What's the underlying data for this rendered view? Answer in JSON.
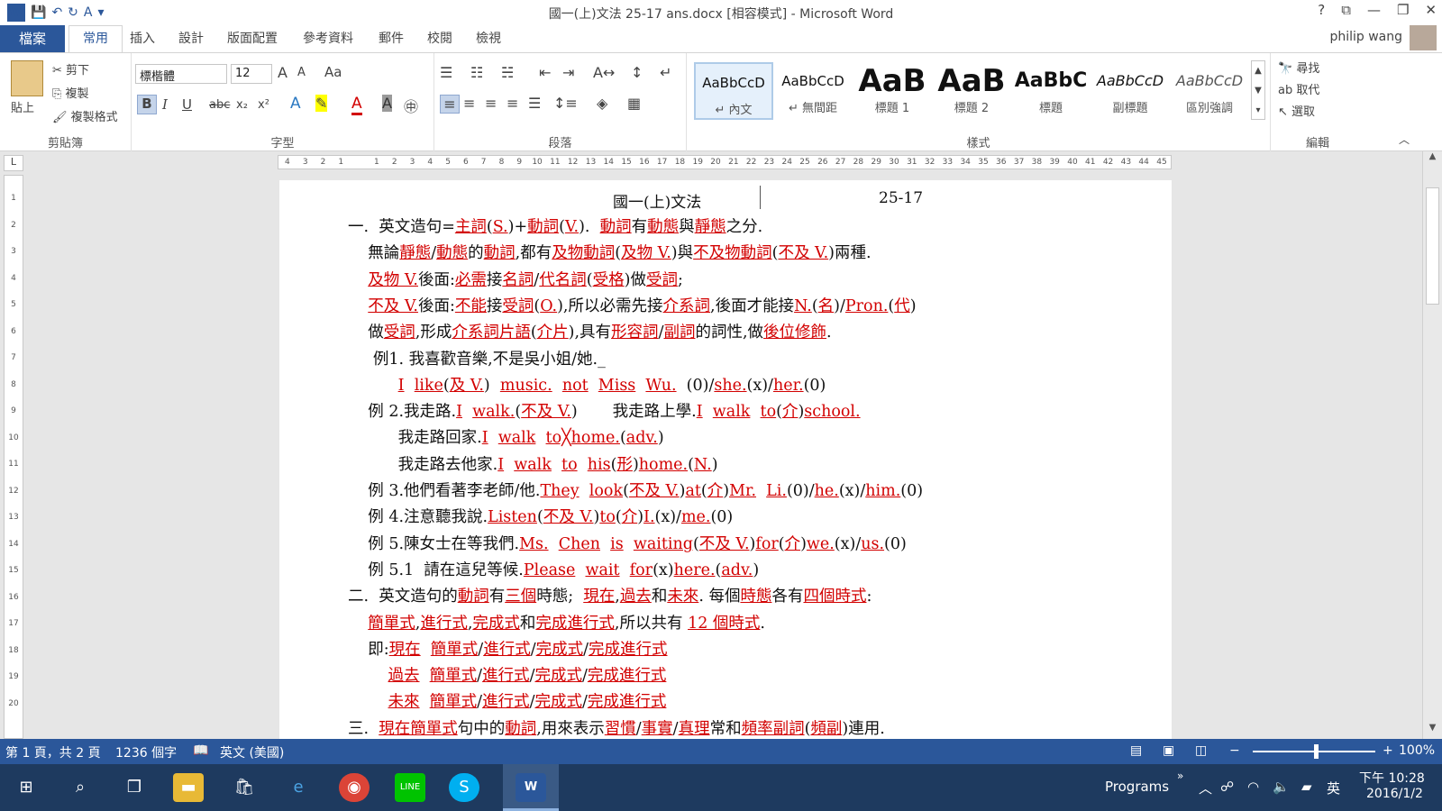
{
  "window": {
    "title": "國一(上)文法 25-17 ans.docx [相容模式] - Microsoft Word",
    "controls": {
      "help": "?",
      "restore": "⧉",
      "minimize": "—",
      "maximize": "❐",
      "close": "✕"
    }
  },
  "quick_access": {
    "app": "W",
    "save": "💾",
    "undo": "↶",
    "redo": "↻",
    "format": "A",
    "more": "▾"
  },
  "tabs": [
    "檔案",
    "常用",
    "插入",
    "設計",
    "版面配置",
    "參考資料",
    "郵件",
    "校閱",
    "檢視"
  ],
  "user": "philip wang",
  "ribbon": {
    "clipboard": {
      "label": "剪貼簿",
      "paste": "貼上",
      "cut": "剪下",
      "copy": "複製",
      "format_painter": "複製格式"
    },
    "font": {
      "label": "字型",
      "font_name": "標楷體",
      "font_size": "12",
      "grow": "A",
      "shrink": "A",
      "case": "Aa",
      "bold": "B",
      "italic": "I",
      "underline": "U",
      "strike": "abc",
      "sub": "x₂",
      "sup": "x²"
    },
    "paragraph": {
      "label": "段落"
    },
    "styles": {
      "label": "樣式",
      "items": [
        {
          "sample": "AaBbCcD",
          "name": "↵ 內文"
        },
        {
          "sample": "AaBbCcD",
          "name": "↵ 無間距"
        },
        {
          "sample": "AaB",
          "name": "標題 1"
        },
        {
          "sample": "AaB",
          "name": "標題 2"
        },
        {
          "sample": "AaBbC",
          "name": "標題"
        },
        {
          "sample": "AaBbCcD",
          "name": "副標題"
        },
        {
          "sample": "AaBbCcD",
          "name": "區別強調"
        }
      ]
    },
    "editing": {
      "label": "編輯",
      "find": "尋找",
      "replace": "取代",
      "select": "選取"
    }
  },
  "ruler": [
    "4",
    "3",
    "2",
    "1",
    "",
    "1",
    "2",
    "3",
    "4",
    "5",
    "6",
    "7",
    "8",
    "9",
    "10",
    "11",
    "12",
    "13",
    "14",
    "15",
    "16",
    "17",
    "18",
    "19",
    "20",
    "21",
    "22",
    "23",
    "24",
    "25",
    "26",
    "27",
    "28",
    "29",
    "30",
    "31",
    "32",
    "33",
    "34",
    "35",
    "36",
    "37",
    "38",
    "39",
    "40",
    "41",
    "42",
    "43",
    "44",
    "45"
  ],
  "vruler": [
    "1",
    "2",
    "3",
    "4",
    "5",
    "6",
    "7",
    "8",
    "9",
    "10",
    "11",
    "12",
    "13",
    "14",
    "15",
    "16",
    "17",
    "18",
    "19",
    "20"
  ],
  "document": {
    "header_title": "國一(上)文法",
    "header_num": "25-17",
    "lines": [
      [
        {
          "t": "一.  英文造句="
        },
        {
          "t": "主詞",
          "r": true
        },
        {
          "t": "("
        },
        {
          "t": "S.",
          "r": true
        },
        {
          "t": ")+"
        },
        {
          "t": "動詞",
          "r": true
        },
        {
          "t": "("
        },
        {
          "t": "V.",
          "r": true
        },
        {
          "t": ").  "
        },
        {
          "t": "動詞",
          "r": true
        },
        {
          "t": "有"
        },
        {
          "t": "動態",
          "r": true
        },
        {
          "t": "與"
        },
        {
          "t": "靜態",
          "r": true
        },
        {
          "t": "之分."
        }
      ],
      [
        {
          "t": "    無論"
        },
        {
          "t": "靜態",
          "r": true
        },
        {
          "t": "/"
        },
        {
          "t": "動態",
          "r": true
        },
        {
          "t": "的"
        },
        {
          "t": "動詞",
          "r": true
        },
        {
          "t": ",都有"
        },
        {
          "t": "及物動詞",
          "r": true
        },
        {
          "t": "("
        },
        {
          "t": "及物 V.",
          "r": true
        },
        {
          "t": ")與"
        },
        {
          "t": "不及物動詞",
          "r": true
        },
        {
          "t": "("
        },
        {
          "t": "不及 V.",
          "r": true
        },
        {
          "t": ")兩種."
        }
      ],
      [
        {
          "t": "    "
        },
        {
          "t": "及物 V.",
          "r": true
        },
        {
          "t": "後面:"
        },
        {
          "t": "必需",
          "r": true
        },
        {
          "t": "接"
        },
        {
          "t": "名詞",
          "r": true
        },
        {
          "t": "/"
        },
        {
          "t": "代名詞",
          "r": true
        },
        {
          "t": "("
        },
        {
          "t": "受格",
          "r": true
        },
        {
          "t": ")做"
        },
        {
          "t": "受詞",
          "r": true
        },
        {
          "t": ";"
        }
      ],
      [
        {
          "t": "    "
        },
        {
          "t": "不及 V.",
          "r": true
        },
        {
          "t": "後面:"
        },
        {
          "t": "不能",
          "r": true
        },
        {
          "t": "接"
        },
        {
          "t": "受詞",
          "r": true
        },
        {
          "t": "("
        },
        {
          "t": "O.",
          "r": true
        },
        {
          "t": "),所以必需先接"
        },
        {
          "t": "介系詞",
          "r": true
        },
        {
          "t": ",後面才能接"
        },
        {
          "t": "N.",
          "r": true
        },
        {
          "t": "("
        },
        {
          "t": "名",
          "r": true
        },
        {
          "t": ")/"
        },
        {
          "t": "Pron.",
          "r": true
        },
        {
          "t": "("
        },
        {
          "t": "代",
          "r": true
        },
        {
          "t": ")"
        }
      ],
      [
        {
          "t": "    做"
        },
        {
          "t": "受詞",
          "r": true
        },
        {
          "t": ",形成"
        },
        {
          "t": "介系詞片語",
          "r": true
        },
        {
          "t": "("
        },
        {
          "t": "介片",
          "r": true
        },
        {
          "t": "),具有"
        },
        {
          "t": "形容詞",
          "r": true
        },
        {
          "t": "/"
        },
        {
          "t": "副詞",
          "r": true
        },
        {
          "t": "的詞性,做"
        },
        {
          "t": "後位修飾",
          "r": true
        },
        {
          "t": "."
        }
      ],
      [
        {
          "t": "     例1. 我喜歡音樂,不是吳小姐/她._"
        }
      ],
      [
        {
          "t": "          "
        },
        {
          "t": "I",
          "r": true
        },
        {
          "t": "  "
        },
        {
          "t": "like",
          "r": true
        },
        {
          "t": "("
        },
        {
          "t": "及 V.",
          "r": true
        },
        {
          "t": ")  "
        },
        {
          "t": "music.",
          "r": true
        },
        {
          "t": "  "
        },
        {
          "t": "not",
          "r": true
        },
        {
          "t": "  "
        },
        {
          "t": "Miss",
          "r": true
        },
        {
          "t": "  "
        },
        {
          "t": "Wu.",
          "r": true
        },
        {
          "t": "  (0)/"
        },
        {
          "t": "she.",
          "r": true
        },
        {
          "t": "(x)/"
        },
        {
          "t": "her.",
          "r": true
        },
        {
          "t": "(0)"
        }
      ],
      [
        {
          "t": "    例 2.我走路."
        },
        {
          "t": "I",
          "r": true
        },
        {
          "t": "  "
        },
        {
          "t": "walk.",
          "r": true
        },
        {
          "t": "("
        },
        {
          "t": "不及 V.",
          "r": true
        },
        {
          "t": ")       我走路上學."
        },
        {
          "t": "I",
          "r": true
        },
        {
          "t": "  "
        },
        {
          "t": "walk",
          "r": true
        },
        {
          "t": "  "
        },
        {
          "t": "to",
          "r": true
        },
        {
          "t": "("
        },
        {
          "t": "介",
          "r": true
        },
        {
          "t": ")"
        },
        {
          "t": "school.",
          "r": true
        }
      ],
      [
        {
          "t": "          我走路回家."
        },
        {
          "t": "I",
          "r": true
        },
        {
          "t": "  "
        },
        {
          "t": "walk",
          "r": true
        },
        {
          "t": "  "
        },
        {
          "t": "to╳",
          "r": true
        },
        {
          "t": "home.",
          "r": true
        },
        {
          "t": "("
        },
        {
          "t": "adv.",
          "r": true
        },
        {
          "t": ")"
        }
      ],
      [
        {
          "t": "          我走路去他家."
        },
        {
          "t": "I",
          "r": true
        },
        {
          "t": "  "
        },
        {
          "t": "walk",
          "r": true
        },
        {
          "t": "  "
        },
        {
          "t": "to",
          "r": true
        },
        {
          "t": "  "
        },
        {
          "t": "his",
          "r": true
        },
        {
          "t": "("
        },
        {
          "t": "形",
          "r": true
        },
        {
          "t": ")"
        },
        {
          "t": "home.",
          "r": true
        },
        {
          "t": "("
        },
        {
          "t": "N.",
          "r": true
        },
        {
          "t": ")"
        }
      ],
      [
        {
          "t": "    例 3.他們看著李老師/他."
        },
        {
          "t": "They",
          "r": true
        },
        {
          "t": "  "
        },
        {
          "t": "look",
          "r": true
        },
        {
          "t": "("
        },
        {
          "t": "不及 V.",
          "r": true
        },
        {
          "t": ")"
        },
        {
          "t": "at",
          "r": true
        },
        {
          "t": "("
        },
        {
          "t": "介",
          "r": true
        },
        {
          "t": ")"
        },
        {
          "t": "Mr.",
          "r": true
        },
        {
          "t": "  "
        },
        {
          "t": "Li.",
          "r": true
        },
        {
          "t": "(0)/"
        },
        {
          "t": "he.",
          "r": true
        },
        {
          "t": "(x)/"
        },
        {
          "t": "him.",
          "r": true
        },
        {
          "t": "(0)"
        }
      ],
      [
        {
          "t": "    例 4.注意聽我說."
        },
        {
          "t": "Listen",
          "r": true
        },
        {
          "t": "("
        },
        {
          "t": "不及 V.",
          "r": true
        },
        {
          "t": ")"
        },
        {
          "t": "to",
          "r": true
        },
        {
          "t": "("
        },
        {
          "t": "介",
          "r": true
        },
        {
          "t": ")"
        },
        {
          "t": "I.",
          "r": true
        },
        {
          "t": "(x)/"
        },
        {
          "t": "me.",
          "r": true
        },
        {
          "t": "(0)"
        }
      ],
      [
        {
          "t": "    例 5.陳女士在等我們."
        },
        {
          "t": "Ms.",
          "r": true
        },
        {
          "t": "  "
        },
        {
          "t": "Chen",
          "r": true
        },
        {
          "t": "  "
        },
        {
          "t": "is",
          "r": true
        },
        {
          "t": "  "
        },
        {
          "t": "waiting",
          "r": true
        },
        {
          "t": "("
        },
        {
          "t": "不及 V.",
          "r": true
        },
        {
          "t": ")"
        },
        {
          "t": "for",
          "r": true
        },
        {
          "t": "("
        },
        {
          "t": "介",
          "r": true
        },
        {
          "t": ")"
        },
        {
          "t": "we.",
          "r": true
        },
        {
          "t": "(x)/"
        },
        {
          "t": "us.",
          "r": true
        },
        {
          "t": "(0)"
        }
      ],
      [
        {
          "t": "    例 5.1  請在這兒等候."
        },
        {
          "t": "Please",
          "r": true
        },
        {
          "t": "  "
        },
        {
          "t": "wait",
          "r": true
        },
        {
          "t": "  "
        },
        {
          "t": "for",
          "r": true
        },
        {
          "t": "(x)"
        },
        {
          "t": "here.",
          "r": true
        },
        {
          "t": "("
        },
        {
          "t": "adv.",
          "r": true
        },
        {
          "t": ")"
        }
      ],
      [
        {
          "t": "二.  英文造句的"
        },
        {
          "t": "動詞",
          "r": true
        },
        {
          "t": "有"
        },
        {
          "t": "三個",
          "r": true
        },
        {
          "t": "時態;  "
        },
        {
          "t": "現在",
          "r": true
        },
        {
          "t": ","
        },
        {
          "t": "過去",
          "r": true
        },
        {
          "t": "和"
        },
        {
          "t": "未來",
          "r": true
        },
        {
          "t": ". 每個"
        },
        {
          "t": "時態",
          "r": true
        },
        {
          "t": "各有"
        },
        {
          "t": "四個時式",
          "r": true
        },
        {
          "t": ":"
        }
      ],
      [
        {
          "t": "    "
        },
        {
          "t": "簡單式",
          "r": true
        },
        {
          "t": ","
        },
        {
          "t": "進行式",
          "r": true
        },
        {
          "t": ","
        },
        {
          "t": "完成式",
          "r": true
        },
        {
          "t": "和"
        },
        {
          "t": "完成進行式",
          "r": true
        },
        {
          "t": ",所以共有 "
        },
        {
          "t": "12 個時式",
          "r": true
        },
        {
          "t": "."
        }
      ],
      [
        {
          "t": "    即:"
        },
        {
          "t": "現在",
          "r": true
        },
        {
          "t": "  "
        },
        {
          "t": "簡單式",
          "r": true
        },
        {
          "t": "/"
        },
        {
          "t": "進行式",
          "r": true
        },
        {
          "t": "/"
        },
        {
          "t": "完成式",
          "r": true
        },
        {
          "t": "/"
        },
        {
          "t": "完成進行式",
          "r": true
        }
      ],
      [
        {
          "t": "        "
        },
        {
          "t": "過去",
          "r": true
        },
        {
          "t": "  "
        },
        {
          "t": "簡單式",
          "r": true
        },
        {
          "t": "/"
        },
        {
          "t": "進行式",
          "r": true
        },
        {
          "t": "/"
        },
        {
          "t": "完成式",
          "r": true
        },
        {
          "t": "/"
        },
        {
          "t": "完成進行式",
          "r": true
        }
      ],
      [
        {
          "t": "        "
        },
        {
          "t": "未來",
          "r": true
        },
        {
          "t": "  "
        },
        {
          "t": "簡單式",
          "r": true
        },
        {
          "t": "/"
        },
        {
          "t": "進行式",
          "r": true
        },
        {
          "t": "/"
        },
        {
          "t": "完成式",
          "r": true
        },
        {
          "t": "/"
        },
        {
          "t": "完成進行式",
          "r": true
        }
      ],
      [
        {
          "t": "三.  "
        },
        {
          "t": "現在簡單式",
          "r": true
        },
        {
          "t": "句中的"
        },
        {
          "t": "動詞",
          "r": true
        },
        {
          "t": ",用來表示"
        },
        {
          "t": "習慣",
          "r": true
        },
        {
          "t": "/"
        },
        {
          "t": "事實",
          "r": true
        },
        {
          "t": "/"
        },
        {
          "t": "真理",
          "r": true
        },
        {
          "t": "常和"
        },
        {
          "t": "頻率副詞",
          "r": true
        },
        {
          "t": "("
        },
        {
          "t": "頻副",
          "r": true
        },
        {
          "t": ")連用."
        }
      ]
    ]
  },
  "status": {
    "page": "第 1 頁，共 2 頁",
    "words": "1236 個字",
    "language": "英文 (美國)",
    "zoom": "100%",
    "zoom_level": 1.0
  },
  "taskbar": {
    "programs": "Programs",
    "ime": "英",
    "time": "下午 10:28",
    "date": "2016/1/2"
  },
  "colors": {
    "accent": "#2b579a",
    "red_text": "#d20000"
  }
}
